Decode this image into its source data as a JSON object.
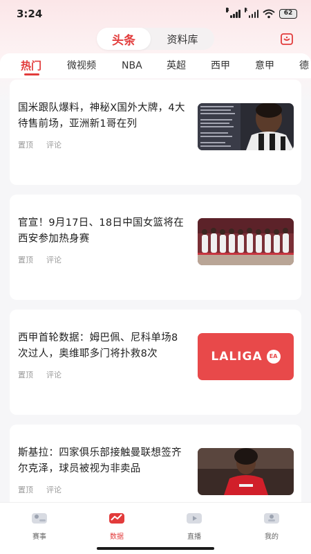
{
  "status_bar": {
    "time": "3:24",
    "battery": "62",
    "signal_1": "R",
    "signal_2": "R"
  },
  "top_tabs": [
    {
      "label": "头条",
      "active": true
    },
    {
      "label": "资料库",
      "active": false
    }
  ],
  "categories": [
    "热门",
    "微视频",
    "NBA",
    "英超",
    "西甲",
    "意甲",
    "德"
  ],
  "articles": [
    {
      "title": "国米跟队爆料，神秘X国外大牌，4大待售前场，亚洲新1哥在列",
      "pin": "置顶",
      "comment": "评论",
      "thumb_icon": "soccer-player-black-white-kit"
    },
    {
      "title": "官宣！9月17日、18日中国女篮将在西安参加热身赛",
      "pin": "置顶",
      "comment": "评论",
      "thumb_icon": "team-lineup-photo"
    },
    {
      "title": "西甲首轮数据：姆巴佩、尼科单场8次过人，奥维耶多门将扑救8次",
      "pin": "置顶",
      "comment": "评论",
      "thumb_logo_text": "LALIGA",
      "thumb_logo_badge": "EA"
    },
    {
      "title": "斯基拉：四家俱乐部接触曼联想签齐尔克泽，球员被视为非卖品",
      "pin": "置顶",
      "comment": "评论",
      "thumb_icon": "player-red-kit"
    }
  ],
  "bottom_nav": [
    {
      "label": "赛事",
      "active": false
    },
    {
      "label": "数据",
      "active": true
    },
    {
      "label": "直播",
      "active": false
    },
    {
      "label": "我的",
      "active": false
    }
  ],
  "colors": {
    "accent": "#e23b3b",
    "laliga_bg": "#e8494a"
  }
}
